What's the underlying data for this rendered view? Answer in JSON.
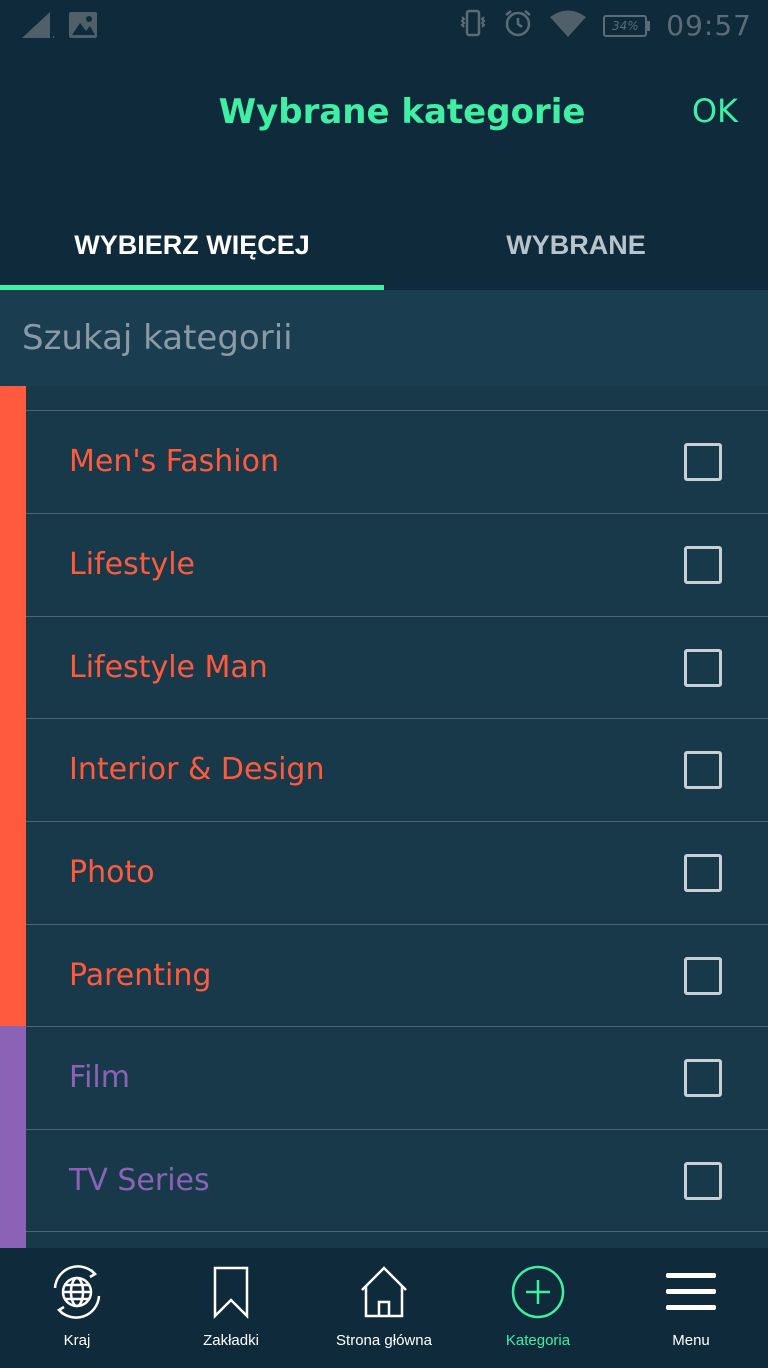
{
  "status_bar": {
    "time": "09:57",
    "battery": "34%"
  },
  "header": {
    "title": "Wybrane kategorie",
    "ok_label": "OK"
  },
  "tabs": [
    {
      "label": "WYBIERZ WIĘCEJ",
      "active": true
    },
    {
      "label": "WYBRANE",
      "active": false
    }
  ],
  "search": {
    "placeholder": "Szukaj kategorii"
  },
  "categories": [
    {
      "label": "Men's Fashion",
      "checked": false,
      "color": "#ff5a3d"
    },
    {
      "label": "Lifestyle",
      "checked": false,
      "color": "#ff5a3d"
    },
    {
      "label": "Lifestyle Man",
      "checked": false,
      "color": "#ff5a3d"
    },
    {
      "label": "Interior & Design",
      "checked": false,
      "color": "#ff5a3d"
    },
    {
      "label": "Photo",
      "checked": false,
      "color": "#ff5a3d"
    },
    {
      "label": "Parenting",
      "checked": false,
      "color": "#ff5a3d"
    },
    {
      "label": "Film",
      "checked": false,
      "color": "#8a63b7"
    },
    {
      "label": "TV Series",
      "checked": false,
      "color": "#8a63b7"
    }
  ],
  "bottom_nav": [
    {
      "label": "Kraj",
      "icon": "globe-icon",
      "active": false
    },
    {
      "label": "Zakładki",
      "icon": "bookmark-icon",
      "active": false
    },
    {
      "label": "Strona główna",
      "icon": "home-icon",
      "active": false
    },
    {
      "label": "Kategoria",
      "icon": "add-circle-icon",
      "active": true
    },
    {
      "label": "Menu",
      "icon": "hamburger-icon",
      "active": false
    }
  ],
  "colors": {
    "accent": "#3ff0a4",
    "header_bg": "#0f2a3a",
    "list_bg": "#17394a",
    "group_orange": "#ff5a3d",
    "group_purple": "#8a63b7"
  }
}
